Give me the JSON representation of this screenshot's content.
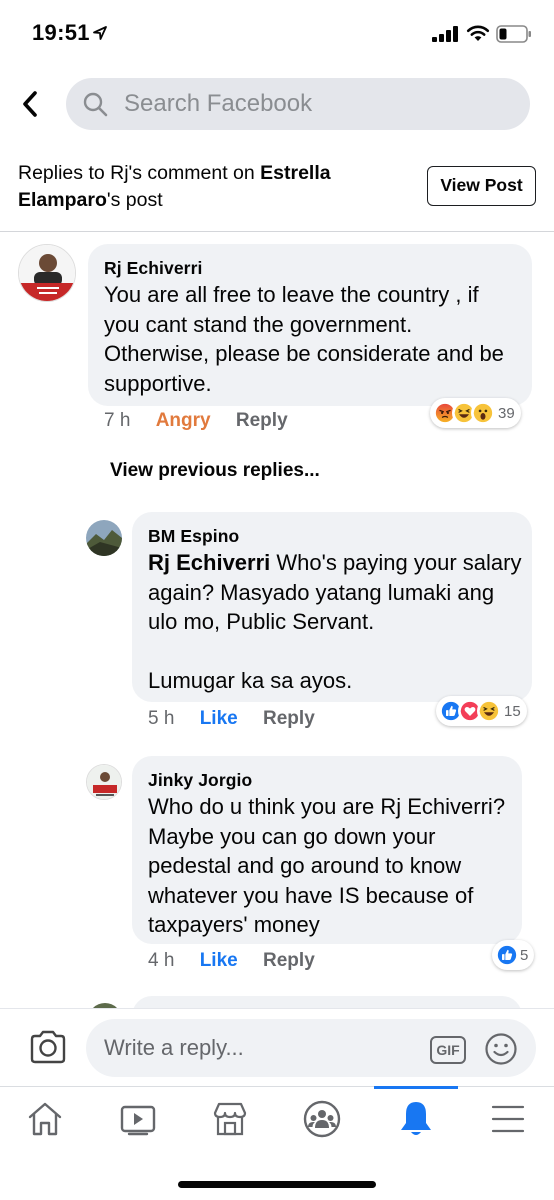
{
  "status_bar": {
    "time": "19:51"
  },
  "header": {
    "search_placeholder": "Search Facebook",
    "back_icon": "chevron-left-icon",
    "search_icon": "search-icon"
  },
  "context": {
    "prefix": "Replies to Rj's comment on ",
    "post_author": "Estrella Elamparo",
    "suffix": "'s post",
    "view_post_label": "View Post"
  },
  "comments": [
    {
      "author": "Rj Echiverri",
      "text": "You are all free to leave the country , if you cant stand the government. Otherwise, please be considerate and be supportive.",
      "time": "7 h",
      "reaction_label": "Angry",
      "reply_label": "Reply",
      "reactions": [
        "angry",
        "haha",
        "wow"
      ],
      "reaction_count": "39"
    },
    {
      "author": "BM Espino",
      "mention": "Rj Echiverri",
      "text": " Who's paying your salary again? Masyado yatang lumaki ang ulo mo, Public Servant.",
      "text2": "Lumugar ka sa ayos.",
      "time": "5 h",
      "reaction_label": "Like",
      "reply_label": "Reply",
      "reactions": [
        "like",
        "love",
        "haha"
      ],
      "reaction_count": "15"
    },
    {
      "author": "Jinky Jorgio",
      "text": "Who do u think you are Rj Echiverri? Maybe you can go down your pedestal and go around to know whatever you have IS because of taxpayers' money",
      "time": "4 h",
      "reaction_label": "Like",
      "reply_label": "Reply",
      "reactions": [
        "like"
      ],
      "reaction_count": "5"
    }
  ],
  "view_previous": "View previous replies...",
  "composer": {
    "placeholder": "Write a reply...",
    "gif_label": "GIF",
    "camera_icon": "camera-icon",
    "emoji_icon": "smiley-icon"
  },
  "tabs": [
    {
      "icon": "home-icon"
    },
    {
      "icon": "video-icon"
    },
    {
      "icon": "marketplace-icon"
    },
    {
      "icon": "groups-icon"
    },
    {
      "icon": "bell-icon",
      "active": true
    },
    {
      "icon": "menu-icon"
    }
  ],
  "colors": {
    "accent": "#1877f2",
    "angry": "#e17a3d",
    "bubble": "#f0f2f5",
    "search_bg": "#e4e6eb",
    "secondary_text": "#65676b"
  }
}
